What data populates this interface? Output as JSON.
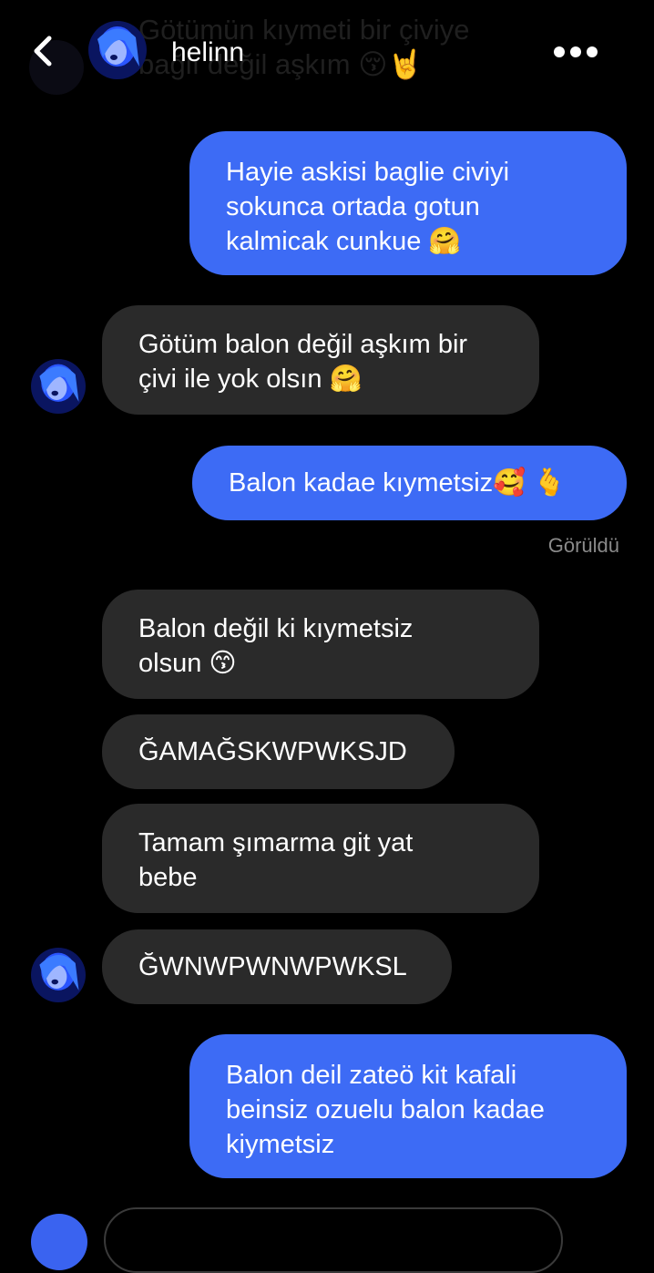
{
  "colors": {
    "background": "#000000",
    "outgoing_bubble": "#3d6bf5",
    "incoming_bubble": "#2a2a2a",
    "seen_text": "#8a8a8a"
  },
  "header": {
    "contact_name": "helinn",
    "back_icon": "chevron-left-icon",
    "more_icon": "more-horizontal-icon",
    "ghost_text": "Götümün kıymeti bir çiviye\nbağlı değil aşkım 😚🤘"
  },
  "messages": [
    {
      "side": "out",
      "text": "Hayie askisi baglie civiyi\nsokunca ortada gotun\nkalmicak cunkue 🤗"
    },
    {
      "side": "in",
      "text": "Götüm balon değil aşkım bir\nçivi ile yok olsın 🤗",
      "avatar": true
    },
    {
      "side": "out",
      "text": "Balon kadae kıymetsiz🥰 🫰"
    },
    {
      "side": "in",
      "text": "Balon değil ki kıymetsiz\nolsun 😙"
    },
    {
      "side": "in",
      "text": "ĞAMAĞSKWPWKSJD"
    },
    {
      "side": "in",
      "text": "Tamam şımarma git yat\nbebe"
    },
    {
      "side": "in",
      "text": "ĞWNWPWNWPWKSL",
      "avatar": true
    },
    {
      "side": "out",
      "text": "Balon deil zateö kit kafali\nbeinsiz ozuelu balon kadae\nkiymetsiz"
    }
  ],
  "status": {
    "seen_label": "Görüldü"
  }
}
